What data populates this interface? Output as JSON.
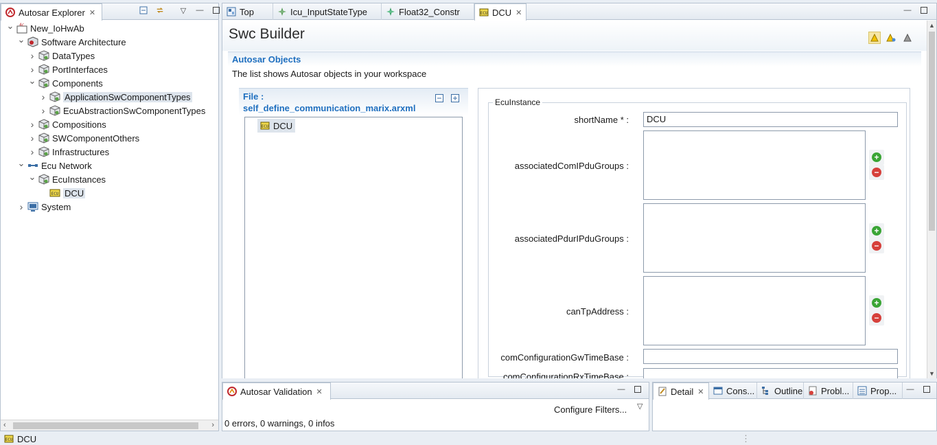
{
  "explorer": {
    "title": "Autosar Explorer",
    "tree": [
      {
        "label": "New_IoHwAb",
        "depth": 0,
        "twisty": "open",
        "icon": "project-icon"
      },
      {
        "label": "Software Architecture",
        "depth": 1,
        "twisty": "open",
        "icon": "package-red-icon"
      },
      {
        "label": "DataTypes",
        "depth": 2,
        "twisty": "closed",
        "icon": "package-icon"
      },
      {
        "label": "PortInterfaces",
        "depth": 2,
        "twisty": "closed",
        "icon": "package-icon"
      },
      {
        "label": "Components",
        "depth": 2,
        "twisty": "open",
        "icon": "package-icon"
      },
      {
        "label": "ApplicationSwComponentTypes",
        "depth": 3,
        "twisty": "closed",
        "icon": "package-icon",
        "selected": true
      },
      {
        "label": "EcuAbstractionSwComponentTypes",
        "depth": 3,
        "twisty": "closed",
        "icon": "package-icon"
      },
      {
        "label": "Compositions",
        "depth": 2,
        "twisty": "closed",
        "icon": "package-icon"
      },
      {
        "label": "SWComponentOthers",
        "depth": 2,
        "twisty": "closed",
        "icon": "package-icon"
      },
      {
        "label": "Infrastructures",
        "depth": 2,
        "twisty": "closed",
        "icon": "package-icon"
      },
      {
        "label": "Ecu Network",
        "depth": 1,
        "twisty": "open",
        "icon": "network-icon"
      },
      {
        "label": "EcuInstances",
        "depth": 2,
        "twisty": "open",
        "icon": "package-icon"
      },
      {
        "label": "DCU",
        "depth": 3,
        "twisty": "none",
        "icon": "ecu-icon",
        "selected": true
      },
      {
        "label": "System",
        "depth": 0,
        "twisty": "closed",
        "icon": "system-icon",
        "indent": 1
      }
    ]
  },
  "editor_tabs": [
    {
      "label": "Top",
      "icon": "diagram-icon"
    },
    {
      "label": "Icu_InputStateType",
      "icon": "datatype-icon"
    },
    {
      "label": "Float32_Constr",
      "icon": "constraint-icon"
    },
    {
      "label": "DCU",
      "icon": "ecu-icon",
      "active": true
    }
  ],
  "editor": {
    "title": "Swc Builder",
    "section_title": "Autosar Objects",
    "section_desc": "The list shows Autosar objects in your workspace",
    "file_label": "File :",
    "file_name": "self_define_communication_marix.arxml",
    "object_list": [
      "DCU"
    ],
    "group_title": "EcuInstance",
    "fields": {
      "shortName_label": "shortName * :",
      "shortName_value": "DCU",
      "associatedComIPduGroups_label": "associatedComIPduGroups :",
      "associatedPdurIPduGroups_label": "associatedPdurIPduGroups :",
      "canTpAddress_label": "canTpAddress :",
      "comConfigurationGwTimeBase_label": "comConfigurationGwTimeBase :",
      "comConfigurationRxTimeBase_label": "comConfigurationRxTimeBase :"
    }
  },
  "validation": {
    "title": "Autosar Validation",
    "configure": "Configure Filters...",
    "summary": "0 errors, 0 warnings, 0 infos"
  },
  "bottom_right_tabs": [
    {
      "label": "Detail",
      "icon": "detail-icon",
      "active": true
    },
    {
      "label": "Cons...",
      "icon": "console-icon"
    },
    {
      "label": "Outline",
      "icon": "outline-icon"
    },
    {
      "label": "Probl...",
      "icon": "problems-icon"
    },
    {
      "label": "Prop...",
      "icon": "properties-icon"
    }
  ],
  "status": {
    "label": "DCU"
  },
  "colors": {
    "accent": "#1f6fbf",
    "selection": "#dde4ec"
  }
}
